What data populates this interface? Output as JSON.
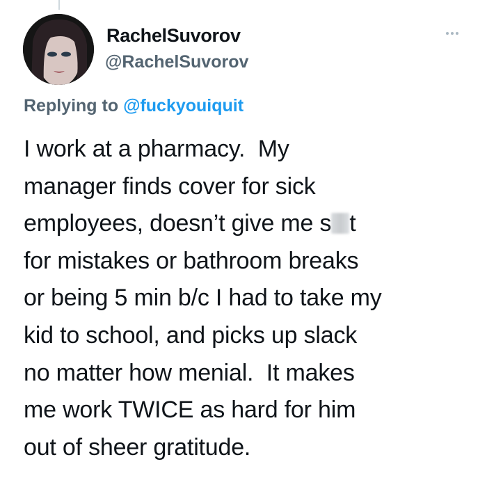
{
  "user": {
    "display_name": "RachelSuvorov",
    "handle": "@RachelSuvorov",
    "avatar_icon": "profile-photo"
  },
  "menu": {
    "icon": "more-options-icon"
  },
  "reply": {
    "prefix": "Replying to ",
    "mention": "@fuckyouiquit"
  },
  "body": {
    "lines": [
      "I work at a pharmacy.  My",
      "manager finds cover for sick",
      "employees, doesn’t give me s",
      "t",
      "for mistakes or bathroom breaks",
      "or being 5 min b/c I had to take my",
      "kid to school, and picks up slack",
      "no matter how menial.  It makes",
      "me work TWICE as hard for him",
      "out of sheer gratitude."
    ]
  },
  "colors": {
    "text": "#0f1419",
    "secondary": "#536471",
    "link": "#1d9bf0"
  }
}
